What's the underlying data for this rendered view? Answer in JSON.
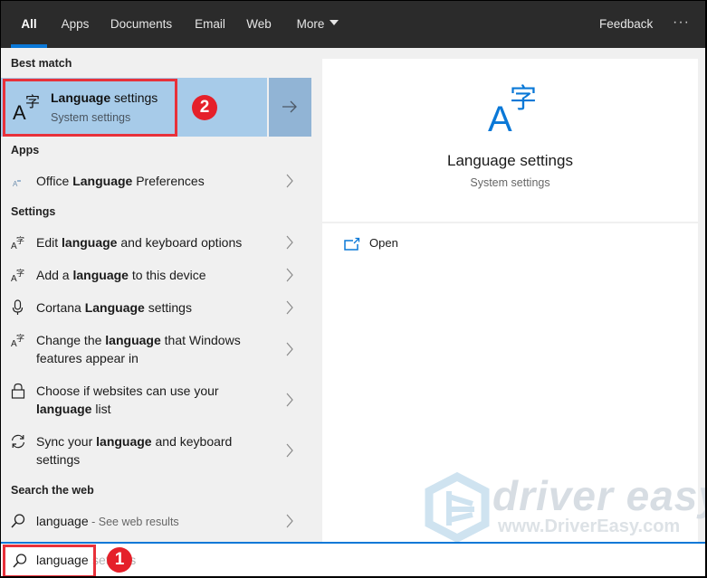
{
  "tabs": [
    {
      "label": "All",
      "active": true
    },
    {
      "label": "Apps"
    },
    {
      "label": "Documents"
    },
    {
      "label": "Email"
    },
    {
      "label": "Web"
    },
    {
      "label": "More"
    }
  ],
  "topbar": {
    "feedback_label": "Feedback",
    "more_options_icon": "ellipsis-icon",
    "more_options_label": "···"
  },
  "best_match": {
    "header": "Best match",
    "title_bold": "Language",
    "title_rest": " settings",
    "subtitle": "System settings",
    "icon": "language-settings-icon",
    "arrow_icon": "arrow-right-icon",
    "annotation_badge": "2"
  },
  "apps": {
    "header": "Apps",
    "items": [
      {
        "pre": "Office ",
        "bold": "Language",
        "post": " Preferences",
        "icon": "office-language-icon"
      }
    ]
  },
  "settings": {
    "header": "Settings",
    "items": [
      {
        "pre": "Edit ",
        "bold": "language",
        "post": " and keyboard options",
        "icon": "language-icon"
      },
      {
        "pre": "Add a ",
        "bold": "language",
        "post": " to this device",
        "icon": "language-icon"
      },
      {
        "pre": "Cortana ",
        "bold": "Language",
        "post": " settings",
        "icon": "microphone-icon"
      },
      {
        "pre": "Change the ",
        "bold": "language",
        "post": " that Windows features appear in",
        "icon": "language-icon"
      },
      {
        "pre": "Choose if websites can use your ",
        "bold": "language",
        "post": " list",
        "icon": "lock-icon"
      },
      {
        "pre": "Sync your ",
        "bold": "language",
        "post": " and keyboard settings",
        "icon": "sync-icon"
      }
    ]
  },
  "web": {
    "header": "Search the web",
    "query": "language",
    "suffix": " - See web results",
    "icon": "search-icon"
  },
  "preview": {
    "title": "Language settings",
    "subtitle": "System settings",
    "actions": [
      {
        "label": "Open",
        "icon": "open-icon"
      }
    ]
  },
  "search": {
    "value": "language",
    "ghost_completion": " settings",
    "ghost_visible": "se     gs",
    "annotation_badge": "1"
  },
  "watermark": {
    "brand": "driver easy",
    "url": "www.DriverEasy.com"
  },
  "colors": {
    "accent": "#0a78d7",
    "selection": "#a7cbe9",
    "annotation_red": "#e5202a",
    "topbar_bg": "#2b2b2b"
  }
}
